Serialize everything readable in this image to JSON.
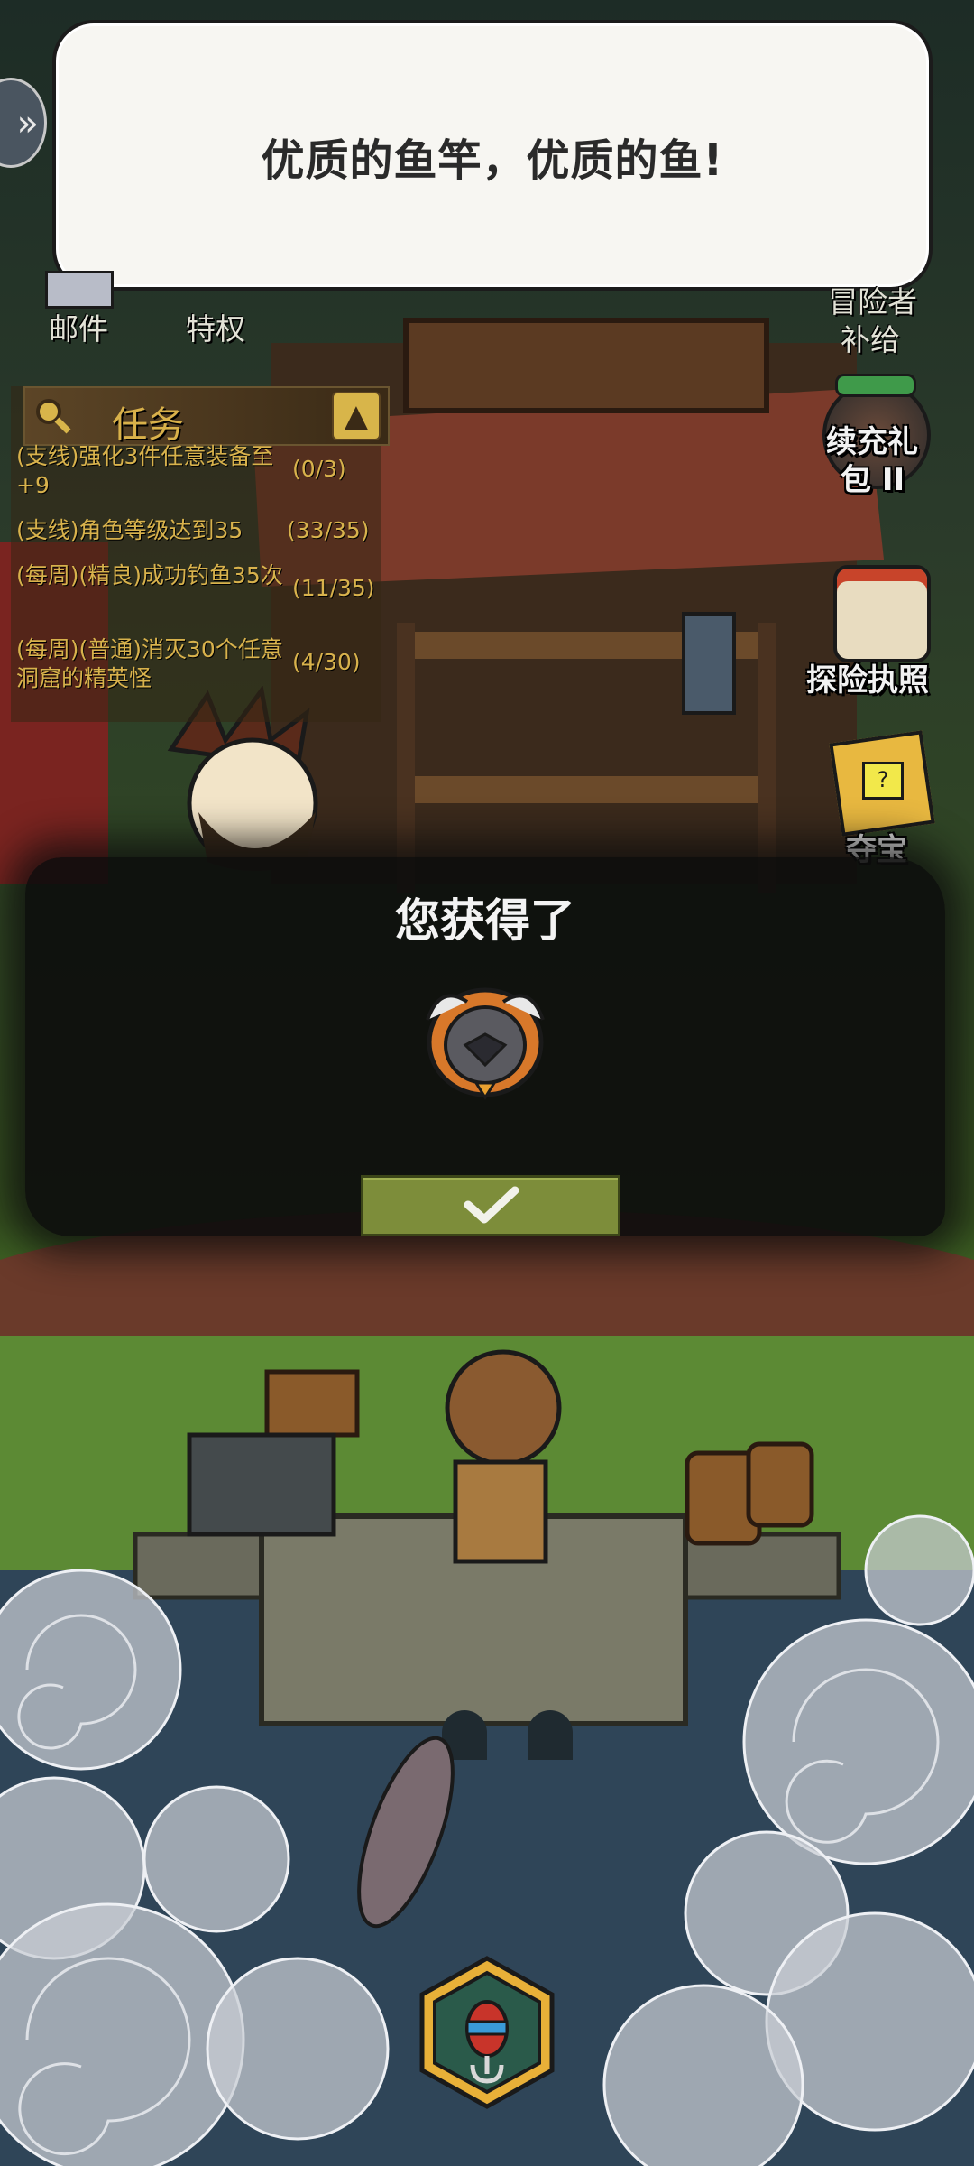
{
  "speech_bubble": {
    "text": "优质的鱼竿，优质的鱼!"
  },
  "top_menu": {
    "mail_label": "邮件",
    "privilege_label": "特权",
    "supply_label_line1": "冒险者",
    "supply_label_line2": "补给"
  },
  "task_panel": {
    "title": "任务",
    "tasks": [
      {
        "text": "(支线)强化3件任意装备至+9",
        "progress": "(0/3)"
      },
      {
        "text": "(支线)角色等级达到35",
        "progress": "(33/35)"
      },
      {
        "text": "(每周)(精良)成功钓鱼35次",
        "progress": "(11/35)"
      },
      {
        "text": "(每周)(普通)消灭30个任意洞窟的精英怪",
        "progress": "(4/30)"
      }
    ]
  },
  "side_buttons": {
    "gift_pack_line1": "续充礼",
    "gift_pack_line2": "包 II",
    "license_label": "探险执照",
    "treasure_label": "夺宝"
  },
  "reward_popup": {
    "title": "您获得了",
    "item_icon": "helmet-icon",
    "confirm_icon": "checkmark-icon"
  },
  "bottom": {
    "bait_icon": "fishing-bait-icon"
  },
  "colors": {
    "task_text": "#d8b24c",
    "confirm_green": "#7d8d3a",
    "bubble_bg": "#f7f6f2"
  }
}
